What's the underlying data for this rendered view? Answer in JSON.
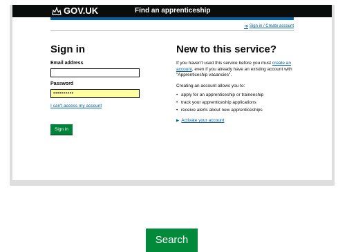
{
  "header": {
    "logo_text": "GOV.UK",
    "service_name": "Find an apprenticeship"
  },
  "top_link": "Sign in / Create account",
  "sign_in": {
    "heading": "Sign in",
    "email_label": "Email address",
    "email_value": "",
    "password_label": "Password",
    "password_value": "••••••••••",
    "cant_access_link": "I can't access my account",
    "button_label": "Sign in"
  },
  "new_service": {
    "heading": "New to this service?",
    "para1_before": "If you haven't used this service before you must ",
    "para1_link": "create an account",
    "para1_after": ", even if you already have an existing account with \"Apprenticeship vacancies\".",
    "para2": "Creating an account allows you to:",
    "bullets": [
      "apply for an apprenticeship or traineeship",
      "track your apprenticeship applications",
      "receive alerts about new apprenticeships"
    ],
    "activate_link": "Activate your account"
  },
  "search_button": "Search",
  "colors": {
    "header_bg": "#0b0c0c",
    "link": "#005ea5",
    "button_green": "#00823b",
    "search_green": "#008a3a",
    "password_bg": "#ffffa0"
  },
  "icons": [
    "crown-icon",
    "arrow-right-icon",
    "triangle-right-icon"
  ]
}
